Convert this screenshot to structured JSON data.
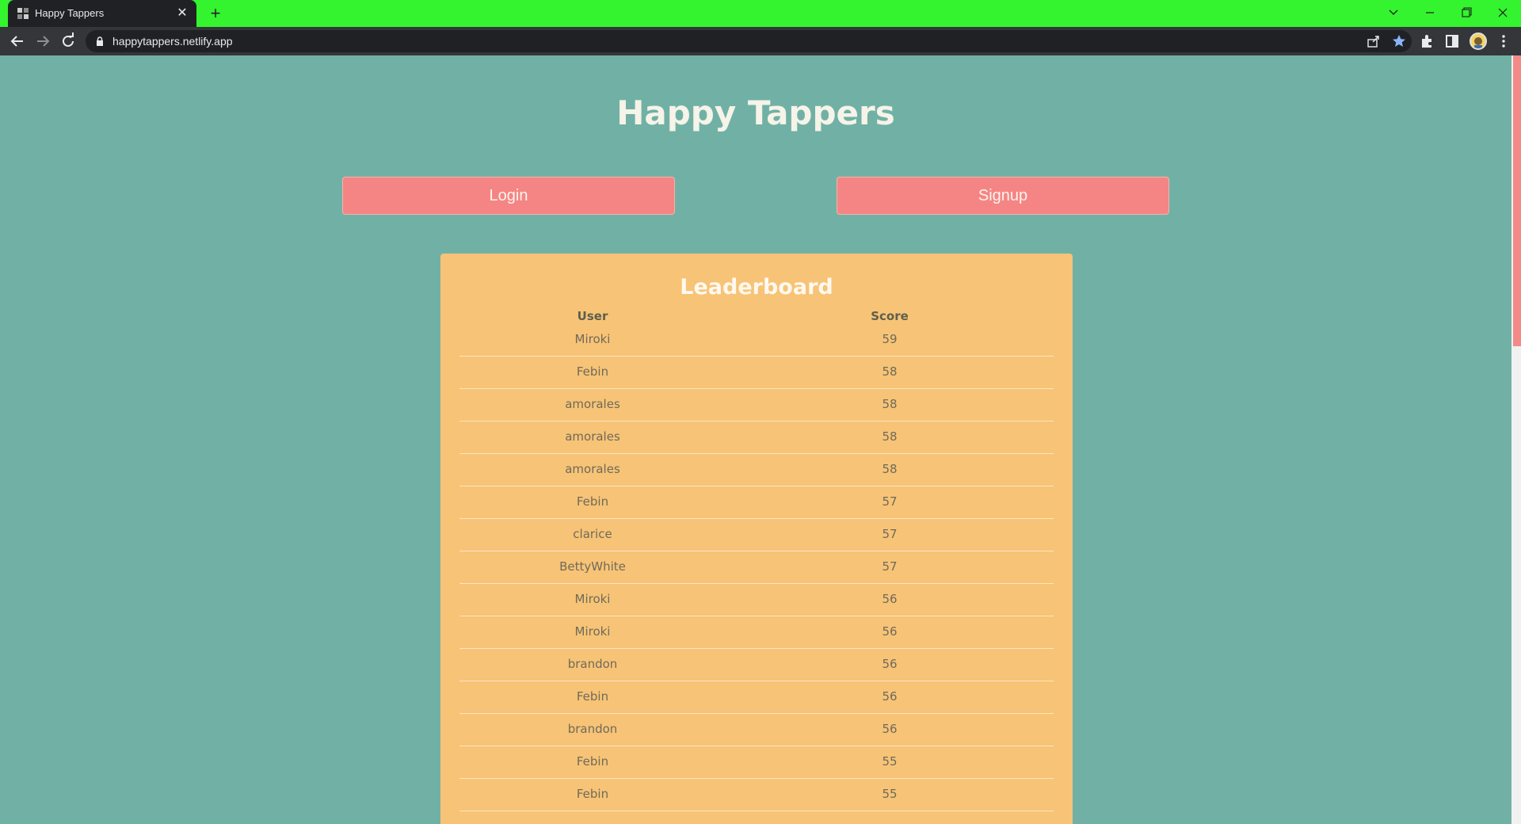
{
  "browser": {
    "tab_title": "Happy Tappers",
    "url": "happytappers.netlify.app"
  },
  "page": {
    "title": "Happy Tappers",
    "login_label": "Login",
    "signup_label": "Signup"
  },
  "leaderboard": {
    "title": "Leaderboard",
    "columns": {
      "user": "User",
      "score": "Score"
    },
    "rows": [
      {
        "user": "Miroki",
        "score": "59"
      },
      {
        "user": "Febin",
        "score": "58"
      },
      {
        "user": "amorales",
        "score": "58"
      },
      {
        "user": "amorales",
        "score": "58"
      },
      {
        "user": "amorales",
        "score": "58"
      },
      {
        "user": "Febin",
        "score": "57"
      },
      {
        "user": "clarice",
        "score": "57"
      },
      {
        "user": "BettyWhite",
        "score": "57"
      },
      {
        "user": "Miroki",
        "score": "56"
      },
      {
        "user": "Miroki",
        "score": "56"
      },
      {
        "user": "brandon",
        "score": "56"
      },
      {
        "user": "Febin",
        "score": "56"
      },
      {
        "user": "brandon",
        "score": "56"
      },
      {
        "user": "Febin",
        "score": "55"
      },
      {
        "user": "Febin",
        "score": "55"
      }
    ]
  }
}
